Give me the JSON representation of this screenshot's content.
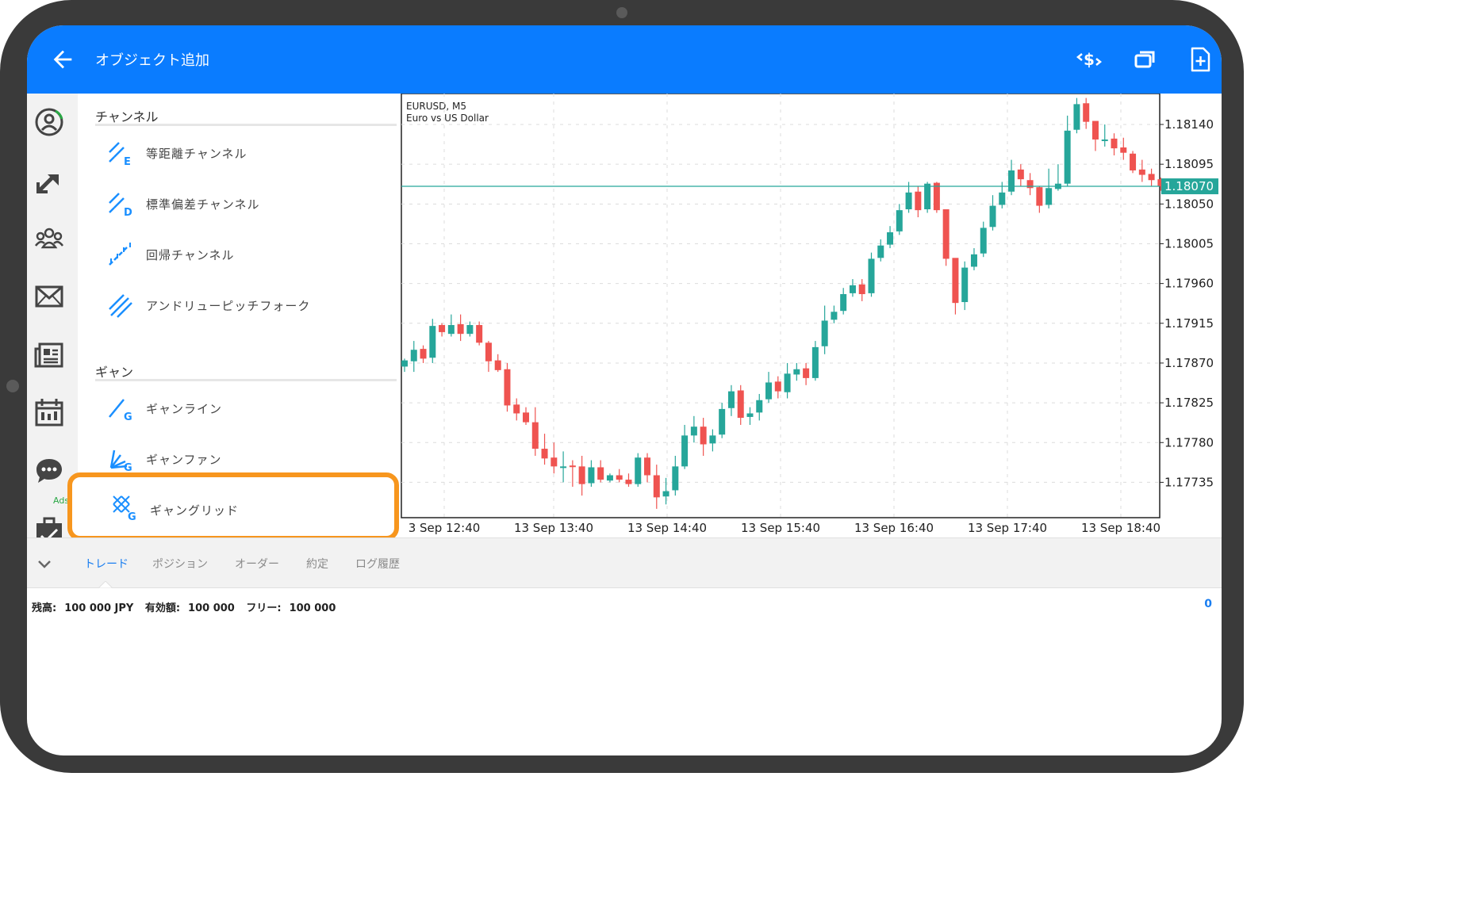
{
  "appbar": {
    "title": "オブジェクト追加"
  },
  "rail": {
    "ads_label": "Ads"
  },
  "panel": {
    "section1_title": "チャンネル",
    "section1_items": [
      "等距離チャンネル",
      "標準偏差チャンネル",
      "回帰チャンネル",
      "アンドリューピッチフォーク"
    ],
    "section2_title": "ギャン",
    "section2_items": [
      "ギャンライン",
      "ギャンファン",
      "ギャングリッド"
    ]
  },
  "chart": {
    "symbol": "EURUSD, M5",
    "description": "Euro vs US Dollar",
    "current_price": "1.18070",
    "colors": {
      "bull": "#26a69a",
      "bear": "#ef5350",
      "price_line": "#26a69a"
    }
  },
  "chart_data": {
    "type": "candlestick",
    "ylim": [
      1.17695,
      1.18175
    ],
    "yticks": [
      "1.18140",
      "1.18095",
      "1.18050",
      "1.18005",
      "1.17960",
      "1.17915",
      "1.17870",
      "1.17825",
      "1.17780",
      "1.17735"
    ],
    "xticks": [
      "3 Sep 12:40",
      "13 Sep 13:40",
      "13 Sep 14:40",
      "13 Sep 15:40",
      "13 Sep 16:40",
      "13 Sep 17:40",
      "13 Sep 18:40"
    ],
    "close": [
      1.17873,
      1.17885,
      1.17875,
      1.17912,
      1.17905,
      1.17913,
      1.17903,
      1.17913,
      1.17893,
      1.17872,
      1.17862,
      1.17822,
      1.17813,
      1.17803,
      1.17773,
      1.17762,
      1.17753,
      1.17753,
      1.17753,
      1.17733,
      1.17752,
      1.17738,
      1.17743,
      1.17738,
      1.17733,
      1.17763,
      1.17743,
      1.17718,
      1.17725,
      1.17753,
      1.17788,
      1.17798,
      1.17778,
      1.17788,
      1.17818,
      1.17838,
      1.17808,
      1.17813,
      1.17828,
      1.17848,
      1.17838,
      1.17858,
      1.17863,
      1.17853,
      1.17888,
      1.17918,
      1.17928,
      1.17948,
      1.17958,
      1.17948,
      1.17988,
      1.18003,
      1.18018,
      1.18043,
      1.18063,
      1.18043,
      1.18073,
      1.18043,
      1.17988,
      1.17938,
      1.17978,
      1.17993,
      1.18023,
      1.18048,
      1.18063,
      1.18088,
      1.18078,
      1.18068,
      1.18048,
      1.18068,
      1.18073,
      1.18133,
      1.18163,
      1.18143,
      1.18123,
      1.18123,
      1.18113,
      1.18108,
      1.18088,
      1.18083,
      1.18077,
      1.1807
    ],
    "open": [
      1.17866,
      1.17872,
      1.17886,
      1.17876,
      1.17913,
      1.17903,
      1.17914,
      1.17903,
      1.17913,
      1.17893,
      1.17873,
      1.17863,
      1.17823,
      1.17814,
      1.17803,
      1.17773,
      1.17763,
      1.17752,
      1.17754,
      1.17753,
      1.17734,
      1.17752,
      1.17737,
      1.17743,
      1.17738,
      1.17733,
      1.17763,
      1.17743,
      1.17719,
      1.17726,
      1.17753,
      1.17788,
      1.17798,
      1.17779,
      1.17789,
      1.17819,
      1.17839,
      1.17809,
      1.17814,
      1.17829,
      1.17849,
      1.17837,
      1.17857,
      1.17864,
      1.17853,
      1.17889,
      1.17919,
      1.17929,
      1.17949,
      1.17959,
      1.17949,
      1.17989,
      1.18004,
      1.18019,
      1.18044,
      1.18064,
      1.18044,
      1.18074,
      1.18044,
      1.17989,
      1.17939,
      1.17979,
      1.17994,
      1.18024,
      1.18049,
      1.18064,
      1.18089,
      1.18077,
      1.18069,
      1.18049,
      1.18067,
      1.18073,
      1.18134,
      1.18164,
      1.18144,
      1.18122,
      1.18124,
      1.18114,
      1.18107,
      1.18089,
      1.18084,
      1.18078
    ],
    "high": [
      1.17875,
      1.17895,
      1.1789,
      1.1792,
      1.17915,
      1.17925,
      1.17925,
      1.17917,
      1.17917,
      1.17895,
      1.1788,
      1.1787,
      1.1783,
      1.1782,
      1.1782,
      1.1779,
      1.1778,
      1.1777,
      1.1776,
      1.17765,
      1.1776,
      1.1776,
      1.17745,
      1.1775,
      1.17745,
      1.17768,
      1.17768,
      1.17755,
      1.1774,
      1.17765,
      1.178,
      1.1781,
      1.17808,
      1.17795,
      1.17825,
      1.17845,
      1.17845,
      1.1782,
      1.17835,
      1.1786,
      1.17855,
      1.1787,
      1.1787,
      1.1787,
      1.17895,
      1.17935,
      1.17935,
      1.17955,
      1.17965,
      1.17965,
      1.17995,
      1.1801,
      1.18025,
      1.1805,
      1.18075,
      1.1807,
      1.18075,
      1.18075,
      1.17995,
      1.17955,
      1.17985,
      1.18,
      1.1803,
      1.1806,
      1.18075,
      1.181,
      1.18095,
      1.18085,
      1.1807,
      1.1809,
      1.18095,
      1.1815,
      1.1817,
      1.1817,
      1.1814,
      1.1814,
      1.1813,
      1.18125,
      1.1811,
      1.181,
      1.1809,
      1.1808
    ],
    "low": [
      1.1786,
      1.1786,
      1.1787,
      1.1787,
      1.179,
      1.179,
      1.17895,
      1.179,
      1.1789,
      1.1786,
      1.1786,
      1.17815,
      1.17805,
      1.178,
      1.17765,
      1.17755,
      1.17745,
      1.17735,
      1.1773,
      1.1772,
      1.1773,
      1.17735,
      1.17735,
      1.17735,
      1.1773,
      1.1773,
      1.17735,
      1.17705,
      1.1771,
      1.1772,
      1.1775,
      1.1778,
      1.17765,
      1.1777,
      1.17785,
      1.1781,
      1.178,
      1.178,
      1.17805,
      1.17825,
      1.1783,
      1.1783,
      1.1785,
      1.17845,
      1.1785,
      1.1788,
      1.17915,
      1.17925,
      1.17945,
      1.1794,
      1.17945,
      1.17985,
      1.18,
      1.18015,
      1.1804,
      1.18035,
      1.1804,
      1.1804,
      1.1798,
      1.17925,
      1.1793,
      1.17975,
      1.1799,
      1.1802,
      1.18045,
      1.1806,
      1.1807,
      1.1806,
      1.1804,
      1.18045,
      1.18065,
      1.1807,
      1.1813,
      1.18135,
      1.1811,
      1.18115,
      1.18105,
      1.181,
      1.18085,
      1.18075,
      1.1807,
      1.18065
    ]
  },
  "tabs": [
    "トレード",
    "ポジション",
    "オーダー",
    "約定",
    "ログ履歴"
  ],
  "status": {
    "balance_label": "残高:",
    "balance_value": "100 000 JPY",
    "equity_label": "有効額:",
    "equity_value": "100 000",
    "free_label": "フリー:",
    "free_value": "100 000",
    "right_value": "0"
  }
}
